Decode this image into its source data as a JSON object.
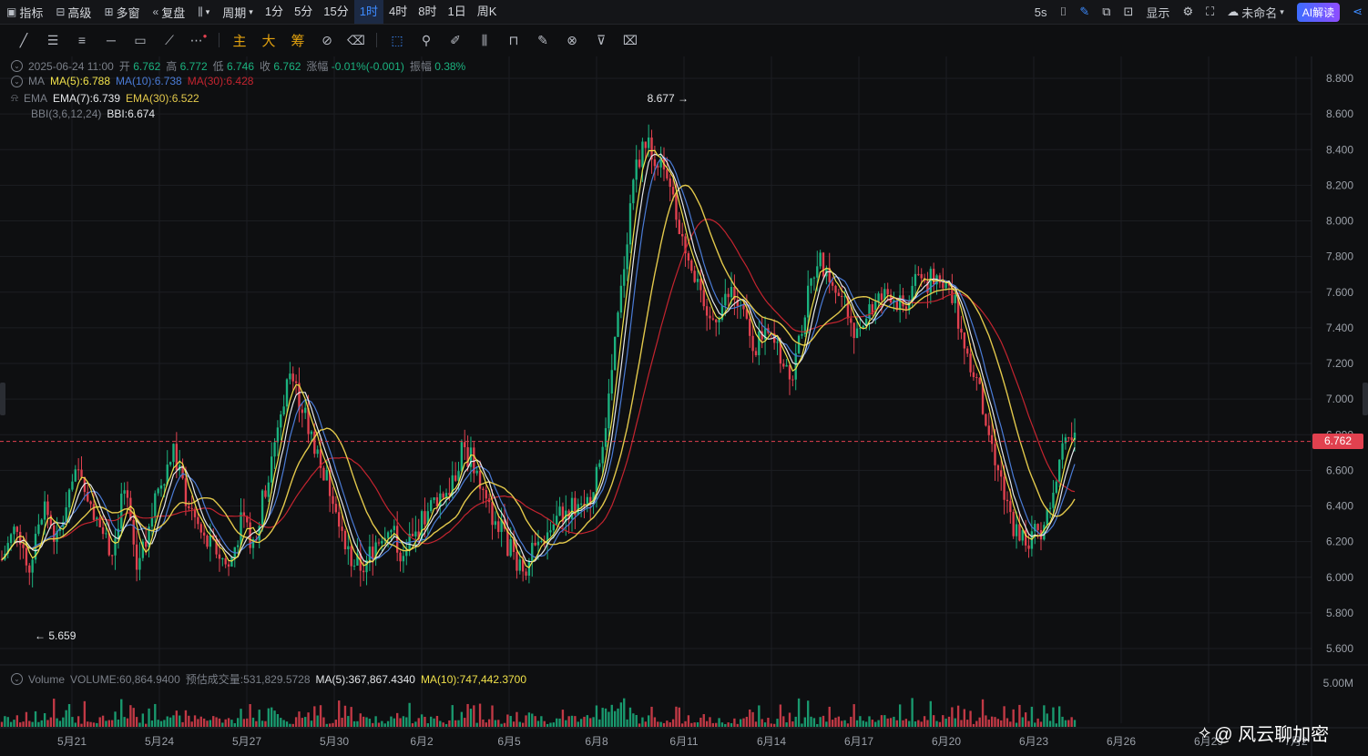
{
  "topbar": {
    "left_items": [
      {
        "icon": "indicator-icon",
        "label": "指标"
      },
      {
        "icon": "advanced-icon",
        "label": "高级"
      },
      {
        "icon": "multi-window-icon",
        "label": "多窗"
      },
      {
        "icon": "replay-icon",
        "label": "复盘"
      },
      {
        "icon": "chart-type-icon",
        "label": ""
      },
      {
        "icon": "",
        "label": "周期"
      }
    ],
    "periods": [
      "1分",
      "5分",
      "15分",
      "1时",
      "4时",
      "8时",
      "1日",
      "周K"
    ],
    "active_period": "1时",
    "right": {
      "refresh": "5s",
      "display_label": "显示",
      "layout_name": "未命名",
      "ai_label": "AI解读"
    }
  },
  "drawing_tools": [
    "line",
    "multi-line",
    "parallel",
    "horizontal",
    "rect",
    "ray",
    "more"
  ],
  "mode_tools": [
    "主",
    "大",
    "筹"
  ],
  "legend": {
    "ohlc": {
      "date": "2025-06-24 11:00",
      "open_label": "开",
      "open": "6.762",
      "high_label": "高",
      "high": "6.772",
      "low_label": "低",
      "low": "6.746",
      "close_label": "收",
      "close": "6.762",
      "change_label": "涨幅",
      "change": "-0.01%(-0.001)",
      "amp_label": "振幅",
      "amp": "0.38%"
    },
    "ma": {
      "name": "MA",
      "ma5": "MA(5):6.788",
      "ma10": "MA(10):6.738",
      "ma30": "MA(30):6.428"
    },
    "ema": {
      "name": "EMA",
      "ema7": "EMA(7):6.739",
      "ema30": "EMA(30):6.522"
    },
    "bbi": {
      "name": "BBI(3,6,12,24)",
      "value": "BBI:6.674"
    },
    "volume": {
      "name": "Volume",
      "vol": "VOLUME:60,864.9400",
      "est": "预估成交量:531,829.5728",
      "ma5": "MA(5):367,867.4340",
      "ma10": "MA(10):747,442.3700"
    }
  },
  "colors": {
    "up": "#1bb27f",
    "down": "#e1414f",
    "ma5": "#f0e14a",
    "ma10": "#4a7bd6",
    "ma30": "#c4242f",
    "ema7": "#e5e7ea",
    "ema30": "#e2c84b",
    "grid": "#1c1e22",
    "bg": "#0e0f11"
  },
  "chart_data": {
    "type": "candlestick",
    "y_ticks": [
      "8.800",
      "8.600",
      "8.400",
      "8.200",
      "8.000",
      "7.800",
      "7.600",
      "7.400",
      "7.200",
      "7.000",
      "6.800",
      "6.600",
      "6.400",
      "6.200",
      "6.000",
      "5.800",
      "5.600"
    ],
    "ylim": [
      5.6,
      8.8
    ],
    "x_labels": [
      "5月21",
      "5月24",
      "5月27",
      "5月30",
      "6月2",
      "6月5",
      "6月8",
      "6月11",
      "6月14",
      "6月17",
      "6月20",
      "6月23",
      "6月26",
      "6月29",
      "7月2"
    ],
    "current_price": "6.762",
    "max_marker": "8.677 →",
    "min_marker": "← 5.659",
    "volume_axis_label": "5.00M",
    "price_path": [
      [
        0,
        6.1
      ],
      [
        5,
        6.3
      ],
      [
        9,
        6.05
      ],
      [
        14,
        6.4
      ],
      [
        18,
        6.2
      ],
      [
        22,
        6.5
      ],
      [
        26,
        6.6
      ],
      [
        30,
        6.35
      ],
      [
        36,
        6.15
      ],
      [
        40,
        6.5
      ],
      [
        44,
        6.05
      ],
      [
        48,
        6.3
      ],
      [
        52,
        6.55
      ],
      [
        56,
        6.7
      ],
      [
        60,
        6.45
      ],
      [
        66,
        6.2
      ],
      [
        70,
        6.15
      ],
      [
        74,
        6.05
      ],
      [
        78,
        6.3
      ],
      [
        82,
        6.2
      ],
      [
        86,
        6.5
      ],
      [
        90,
        6.85
      ],
      [
        94,
        7.15
      ],
      [
        98,
        6.95
      ],
      [
        102,
        6.75
      ],
      [
        106,
        6.55
      ],
      [
        110,
        6.35
      ],
      [
        114,
        6.1
      ],
      [
        118,
        6.05
      ],
      [
        122,
        6.2
      ],
      [
        126,
        6.3
      ],
      [
        130,
        6.15
      ],
      [
        134,
        6.2
      ],
      [
        138,
        6.35
      ],
      [
        142,
        6.45
      ],
      [
        146,
        6.5
      ],
      [
        150,
        6.7
      ],
      [
        154,
        6.65
      ],
      [
        158,
        6.4
      ],
      [
        162,
        6.3
      ],
      [
        166,
        6.15
      ],
      [
        170,
        6.05
      ],
      [
        174,
        6.15
      ],
      [
        178,
        6.25
      ],
      [
        182,
        6.35
      ],
      [
        186,
        6.4
      ],
      [
        190,
        6.35
      ],
      [
        194,
        6.6
      ],
      [
        198,
        7.0
      ],
      [
        202,
        7.6
      ],
      [
        206,
        8.25
      ],
      [
        210,
        8.45
      ],
      [
        214,
        8.35
      ],
      [
        218,
        8.15
      ],
      [
        222,
        7.9
      ],
      [
        226,
        7.7
      ],
      [
        230,
        7.4
      ],
      [
        234,
        7.5
      ],
      [
        238,
        7.6
      ],
      [
        242,
        7.45
      ],
      [
        246,
        7.3
      ],
      [
        250,
        7.35
      ],
      [
        254,
        7.25
      ],
      [
        258,
        7.15
      ],
      [
        262,
        7.5
      ],
      [
        266,
        7.8
      ],
      [
        270,
        7.7
      ],
      [
        274,
        7.55
      ],
      [
        278,
        7.4
      ],
      [
        282,
        7.45
      ],
      [
        286,
        7.55
      ],
      [
        290,
        7.6
      ],
      [
        294,
        7.5
      ],
      [
        298,
        7.7
      ],
      [
        302,
        7.65
      ],
      [
        306,
        7.7
      ],
      [
        310,
        7.6
      ],
      [
        314,
        7.3
      ],
      [
        318,
        7.1
      ],
      [
        322,
        6.8
      ],
      [
        326,
        6.55
      ],
      [
        330,
        6.3
      ],
      [
        334,
        6.2
      ],
      [
        338,
        6.25
      ],
      [
        342,
        6.35
      ],
      [
        346,
        6.7
      ],
      [
        350,
        6.76
      ]
    ],
    "x_total_bars": 350
  }
}
